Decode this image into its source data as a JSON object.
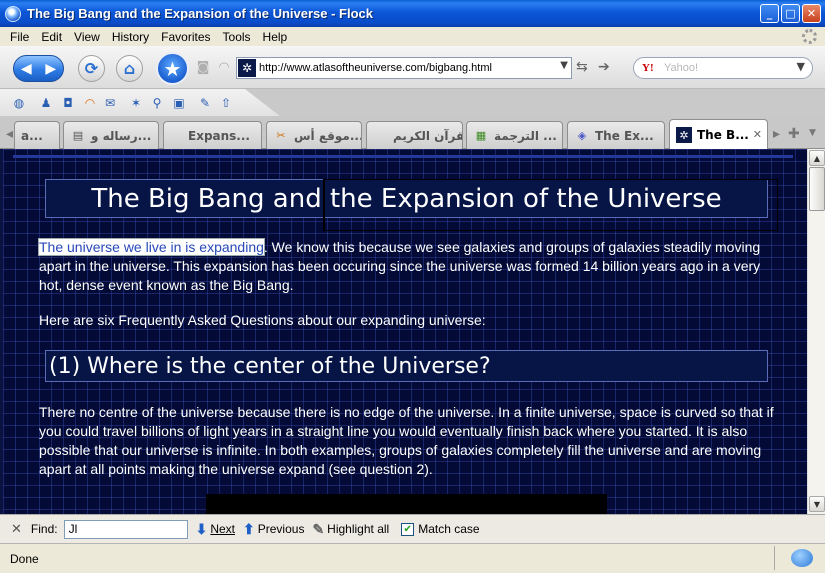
{
  "window": {
    "title": "The Big Bang and the Expansion of the Universe - Flock",
    "minimize_label": "_",
    "maximize_label": "□",
    "close_label": "✕"
  },
  "menu": [
    "File",
    "Edit",
    "View",
    "History",
    "Favorites",
    "Tools",
    "Help"
  ],
  "toolbar": {
    "url": "http://www.atlasoftheuniverse.com/bigbang.html",
    "search_placeholder": "Yahoo!",
    "search_engine_icon": "Y!"
  },
  "tabs": [
    {
      "label": "a...",
      "icon": "",
      "active": false
    },
    {
      "label": "رساله و...",
      "icon": "page-icon",
      "active": false
    },
    {
      "label": "Expans...",
      "icon": "",
      "active": false
    },
    {
      "label": "موقع أس...",
      "icon": "tools-icon",
      "active": false
    },
    {
      "label": "القرآن الكريم",
      "icon": "",
      "active": false
    },
    {
      "label": "الترجمة ...",
      "icon": "google-icon",
      "active": false
    },
    {
      "label": "The Ex...",
      "icon": "page-icon",
      "active": false
    },
    {
      "label": "The B...",
      "icon": "star-icon",
      "active": true
    }
  ],
  "page": {
    "title": "The Big Bang and the Expansion of the Universe",
    "intro_highlight": "The universe we live in is expanding",
    "intro_rest": ". We know this because we see galaxies and groups of galaxies steadily moving apart in the universe. This expansion has been occuring since the universe was formed 14 billion years ago in a very hot, dense event known as the Big Bang.",
    "faq_intro": "Here are six Frequently Asked Questions about our expanding universe:",
    "q1_heading": "(1) Where is the center of the Universe?",
    "q1_answer": "There no centre of the universe because there is no edge of the universe. In a finite universe, space is curved so that if you could travel billions of light years in a straight line you would eventually finish back where you started. It is also possible that our universe is infinite. In both examples, groups of galaxies completely fill the universe and are moving apart at all points making the universe expand (see question 2)."
  },
  "findbar": {
    "close_label": "✕",
    "find_label": "Find:",
    "find_value": "Jl",
    "next_label": "Next",
    "previous_label": "Previous",
    "highlight_label": "Highlight all",
    "match_case_label": "Match case",
    "match_case_checked": true
  },
  "status": {
    "text": "Done"
  },
  "colors": {
    "page_background": "#020a35",
    "highlight_text": "#2849b8",
    "titlebar": "#0b56d8"
  }
}
